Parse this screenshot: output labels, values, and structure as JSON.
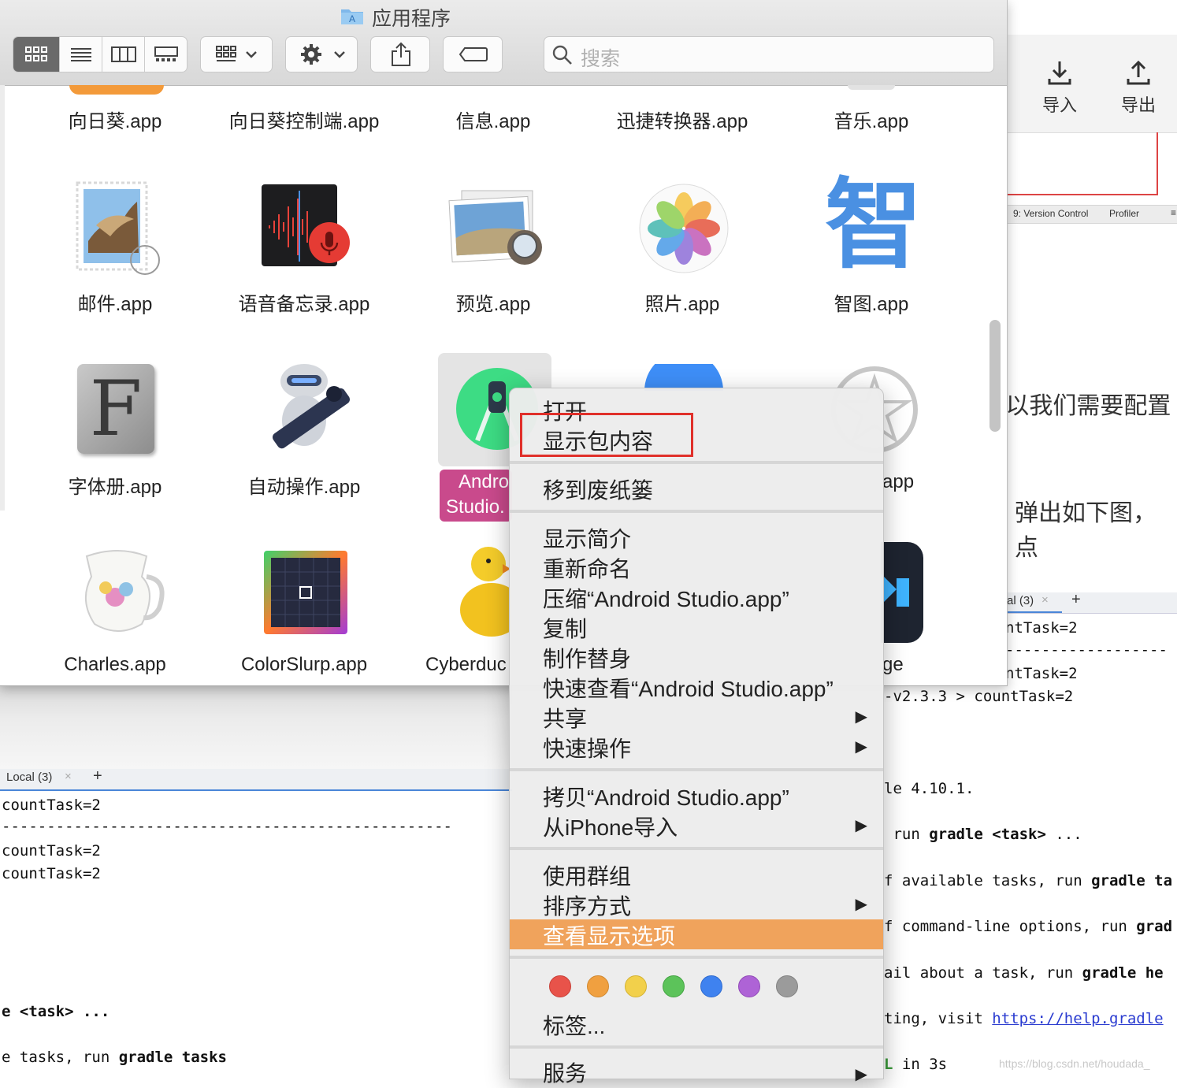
{
  "finder": {
    "title": "应用程序",
    "search_placeholder": "搜索",
    "rows": [
      [
        "向日葵.app",
        "向日葵控制端.app",
        "信息.app",
        "迅捷转换器.app",
        "音乐.app"
      ],
      [
        "邮件.app",
        "语音备忘录.app",
        "预览.app",
        "照片.app",
        "智图.app"
      ],
      [
        "字体册.app",
        "自动操作.app",
        "Andro",
        "Studio.",
        "app"
      ],
      [
        "Charles.app",
        "ColorSlurp.app",
        "Cyberduc",
        "ge"
      ]
    ],
    "zhitu_glyph": "智",
    "font_book_glyph": "F"
  },
  "context_menu": {
    "items": {
      "open": "打开",
      "show_package": "显示包内容",
      "trash": "移到废纸篓",
      "get_info": "显示简介",
      "rename": "重新命名",
      "compress": "压缩“Android Studio.app”",
      "duplicate": "复制",
      "make_alias": "制作替身",
      "quick_look": "快速查看“Android Studio.app”",
      "share": "共享",
      "quick_actions": "快速操作",
      "copy": "拷贝“Android Studio.app”",
      "import_iphone": "从iPhone导入",
      "use_groups": "使用群组",
      "sort_by": "排序方式",
      "view_options": "查看显示选项",
      "tags": "标签...",
      "services": "服务"
    },
    "tag_colors": [
      "#e8534a",
      "#f0a040",
      "#f2d04b",
      "#5cc35a",
      "#3f82ef",
      "#ae63d6",
      "#9b9b9b"
    ],
    "highlight_color": "#f0a35c"
  },
  "ide_right": {
    "import": "导入",
    "export": "导出",
    "status_version": "9: Version Control",
    "status_profiler": "Profiler",
    "text1": "f以我们需要配置",
    "text2": "弹出如下图，点",
    "tab": "al (3)",
    "plus": "+",
    "term": {
      "l1": "ntTask=2",
      "l2": "------------------",
      "l3": "ntTask=2",
      "l4": "-v2.3.3 > countTask=2",
      "l5": "le 4.10.1.",
      "l6a": " run ",
      "l6b": "gradle <task>",
      "l6c": " ...",
      "l7a": "f available tasks, run ",
      "l7b": "gradle ta",
      "l8a": "f command-line options, run ",
      "l8b": "grad",
      "l9a": "ail about a task, run ",
      "l9b": "gradle he",
      "l10a": "ting, visit ",
      "l10b": "https://help.gradle",
      "l11a": "L",
      "l11b": " in 3s",
      "watermark": "https://blog.csdn.net/houdada_"
    }
  },
  "terminal_left": {
    "tab": "Local (3)",
    "close": "×",
    "plus": "+",
    "l1": "countTask=2",
    "l2": "--------------------------------------------------",
    "l3": "countTask=2",
    "l4": "countTask=2",
    "l5": "e <task> ...",
    "l6a": "e tasks, run ",
    "l6b": "gradle tasks"
  }
}
